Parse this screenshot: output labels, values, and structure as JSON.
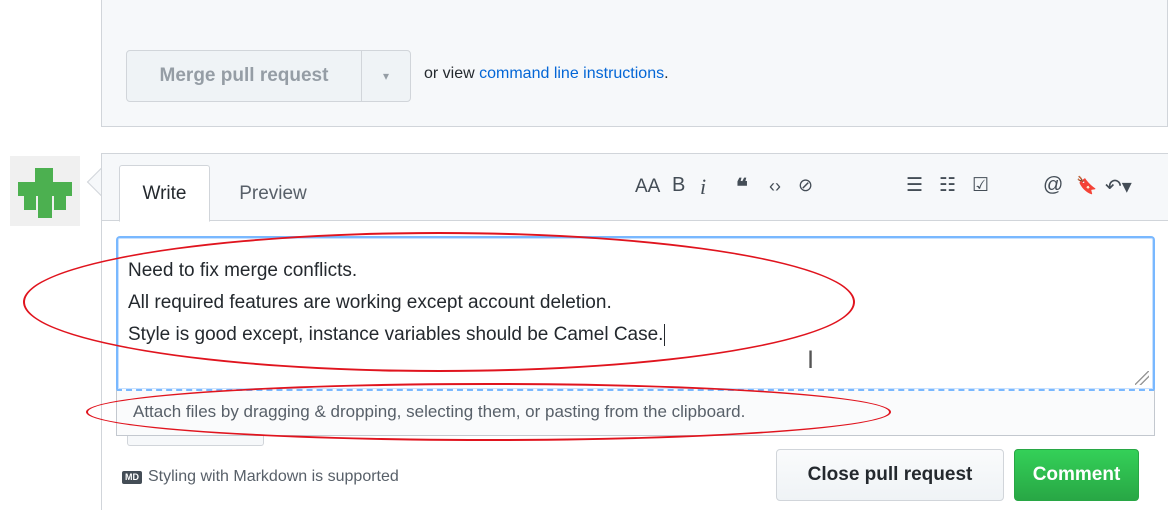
{
  "merge": {
    "button_label": "Merge pull request",
    "caret": "▾",
    "text_prefix": "or view ",
    "link_text": "command line instructions",
    "text_suffix": "."
  },
  "editor": {
    "tabs": [
      {
        "label": "Write",
        "active": true
      },
      {
        "label": "Preview",
        "active": false
      }
    ],
    "toolbar": {
      "heading": "AA",
      "bold": "B",
      "italic": "i",
      "quote": "❝",
      "code": "‹›",
      "link": "⊘",
      "unordered_list": "☰",
      "ordered_list": "☷",
      "task_list": "☑",
      "mention": "@",
      "saved_reply": "🔖",
      "reply": "↶▾"
    },
    "lines": [
      "Need to fix merge conflicts.",
      "All required features are working except account deletion.",
      "Style is good except, instance variables should be Camel Case."
    ],
    "attach_text": "Attach files by dragging & dropping, selecting them, or pasting from the clipboard.",
    "markdown_hint": "Styling with Markdown is supported",
    "markdown_badge": "MD"
  },
  "actions": {
    "close_label": "Close pull request",
    "comment_label": "Comment"
  },
  "colors": {
    "link": "#0366d6",
    "comment_green": "#28a745",
    "annotation_red": "#e0141e",
    "focus_blue": "#79b8ff"
  }
}
